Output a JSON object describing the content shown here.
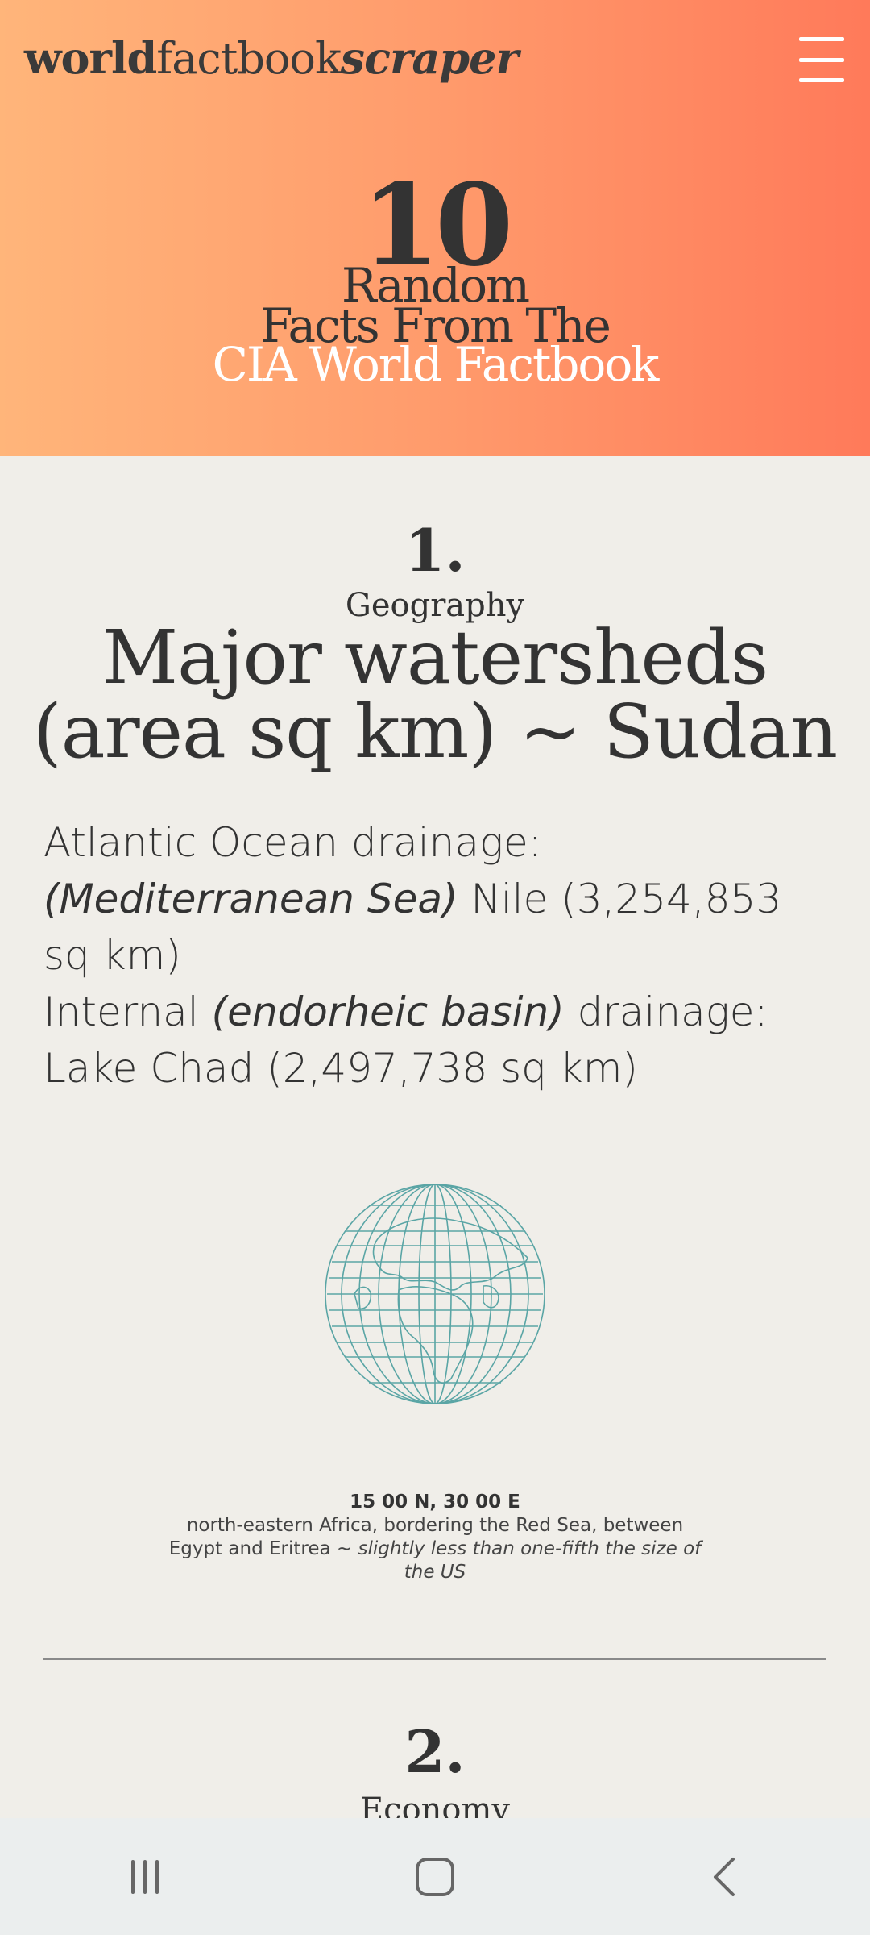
{
  "header": {
    "brand_part1": "world",
    "brand_part2": "factbook",
    "brand_part3": "scraper",
    "menu_icon": "hamburger-menu-icon"
  },
  "hero": {
    "number": "10",
    "line1": "Random",
    "line2": "Facts From The",
    "line3": "CIA World Factbook"
  },
  "fact1": {
    "number": "1.",
    "category": "Geography",
    "title": "Major watersheds (area sq km) ~ Sudan",
    "body_p1_a": "Atlantic Ocean drainage: ",
    "body_p1_italic": "(Mediterranean Sea)",
    "body_p1_b": " Nile (3,254,853 sq km)",
    "body_p2_a": "Internal ",
    "body_p2_italic": "(endorheic basin)",
    "body_p2_b": " drainage: Lake Chad (2,497,738 sq km)",
    "globe_icon": "globe-icon",
    "coordinates": "15 00 N, 30 00 E",
    "location": "north-eastern Africa, bordering the Red Sea, between Egypt and Eritrea ~ ",
    "size_comparison": "slightly less than one-fifth the size of the US"
  },
  "fact2": {
    "number": "2.",
    "category": "Economy"
  },
  "navbar": {
    "recent_icon": "recent-apps-icon",
    "home_icon": "home-icon",
    "back_icon": "back-icon"
  },
  "colors": {
    "hero_gradient_start": "#ffb57a",
    "hero_gradient_end": "#ff7a5a",
    "background": "#f0eee9",
    "globe_stroke": "#5aa5a5"
  }
}
